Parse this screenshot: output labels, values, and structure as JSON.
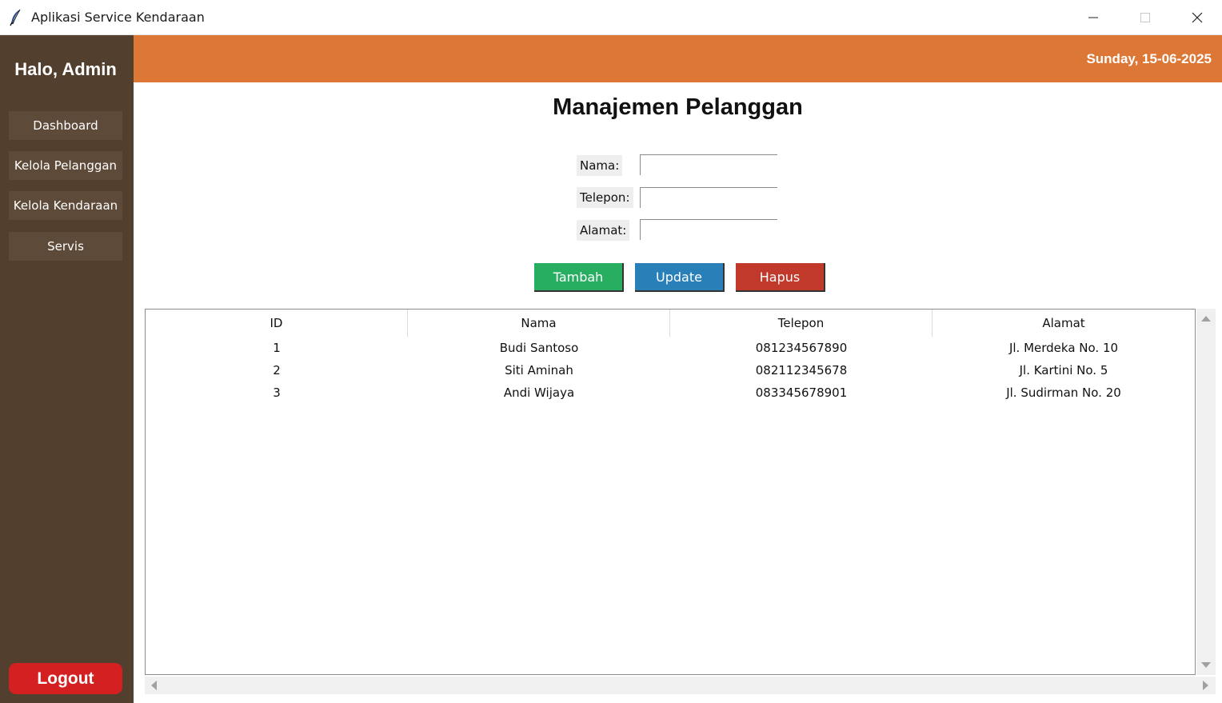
{
  "window": {
    "title": "Aplikasi Service Kendaraan",
    "icons": {
      "app": "feather-icon",
      "minimize": "minimize-icon",
      "maximize": "maximize-icon",
      "close": "close-icon"
    }
  },
  "sidebar": {
    "greeting": "Halo, Admin",
    "items": [
      {
        "label": "Dashboard"
      },
      {
        "label": "Kelola Pelanggan"
      },
      {
        "label": "Kelola Kendaraan"
      },
      {
        "label": "Servis"
      }
    ],
    "logout_label": "Logout"
  },
  "header": {
    "date": "Sunday, 15-06-2025"
  },
  "main": {
    "title": "Manajemen Pelanggan",
    "form": {
      "nama_label": "Nama:",
      "nama_value": "",
      "telepon_label": "Telepon:",
      "telepon_value": "",
      "alamat_label": "Alamat:",
      "alamat_value": ""
    },
    "buttons": {
      "add": "Tambah",
      "update": "Update",
      "delete": "Hapus"
    },
    "table": {
      "columns": [
        "ID",
        "Nama",
        "Telepon",
        "Alamat"
      ],
      "rows": [
        [
          "1",
          "Budi Santoso",
          "081234567890",
          "Jl. Merdeka No. 10"
        ],
        [
          "2",
          "Siti Aminah",
          "082112345678",
          "Jl. Kartini No. 5"
        ],
        [
          "3",
          "Andi Wijaya",
          "083345678901",
          "Jl. Sudirman No. 20"
        ]
      ]
    }
  },
  "colors": {
    "sidebar_bg": "#533f2e",
    "sidebar_button": "#5e4a39",
    "header_bg": "#dc7735",
    "logout": "#d42020",
    "add": "#27ae60",
    "update": "#2980b9",
    "delete": "#c0392b"
  }
}
